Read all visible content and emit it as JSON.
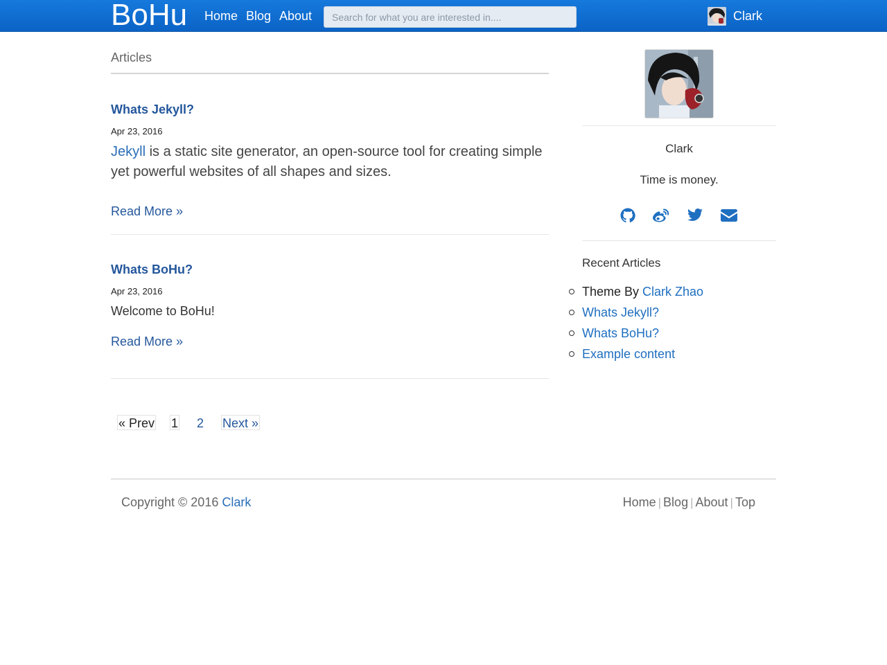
{
  "navbar": {
    "brand": "BoHu",
    "links": [
      {
        "label": "Home"
      },
      {
        "label": "Blog"
      },
      {
        "label": "About"
      }
    ],
    "search_placeholder": "Search for what you are interested in....",
    "user_name": "Clark"
  },
  "main": {
    "section_title": "Articles",
    "posts": [
      {
        "title": "Whats Jekyll?",
        "date": "Apr 23, 2016",
        "body_link": "Jekyll",
        "body_text": " is a static site generator, an open-source tool for creating simple yet powerful websites of all shapes and sizes.",
        "read_more": "Read More »"
      },
      {
        "title": "Whats BoHu?",
        "date": "Apr 23, 2016",
        "body_text": "Welcome to BoHu!",
        "read_more": "Read More »"
      }
    ],
    "pagination": {
      "prev": "« Prev",
      "pages": [
        "1",
        "2"
      ],
      "current": "1",
      "next": "Next »"
    }
  },
  "sidebar": {
    "name": "Clark",
    "motto": "Time is money.",
    "social_icons": [
      "github-icon",
      "weibo-icon",
      "twitter-icon",
      "envelope-icon"
    ],
    "recent_title": "Recent Articles",
    "recent_prefix": "Theme By ",
    "recent_items": [
      "Clark Zhao",
      "Whats Jekyll?",
      "Whats BoHu?",
      "Example content"
    ]
  },
  "footer": {
    "copyright_text": "Copyright © 2016 ",
    "copyright_link": "Clark",
    "links": [
      "Home",
      "Blog",
      "About",
      "Top"
    ]
  },
  "colors": {
    "navbar": "#0b63c6",
    "link": "#24579c",
    "icon": "#1f6fc0"
  }
}
